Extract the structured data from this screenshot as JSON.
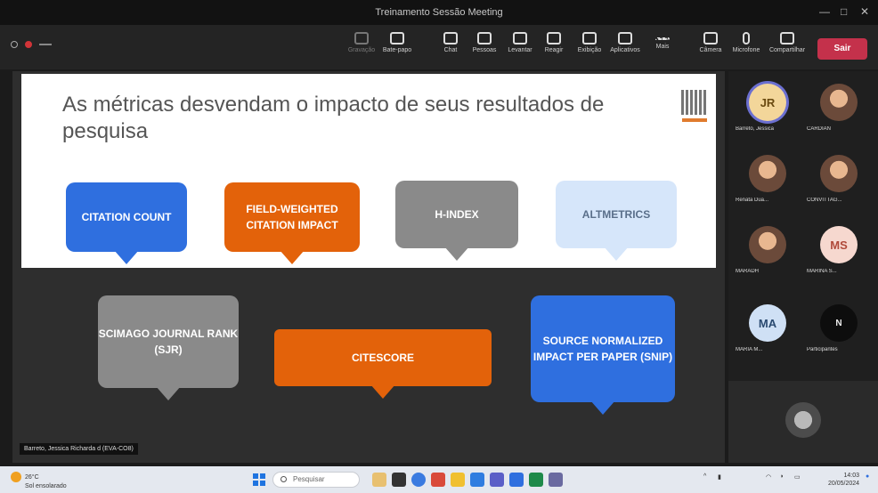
{
  "window": {
    "title": "Treinamento Sessão Meeting"
  },
  "toolbar": {
    "buttons": [
      {
        "label": "Gravação"
      },
      {
        "label": "Bate-papo"
      },
      {
        "label": "Chat"
      },
      {
        "label": "Pessoas"
      },
      {
        "label": "Levantar"
      },
      {
        "label": "Reagir"
      },
      {
        "label": "Exibição"
      },
      {
        "label": "Aplicativos"
      },
      {
        "label": "Mais"
      },
      {
        "label": "Câmera"
      },
      {
        "label": "Microfone"
      },
      {
        "label": "Compartilhar"
      }
    ],
    "leave_label": "Sair"
  },
  "slide": {
    "title": "As métricas desvendam o impacto de seus resultados de pesquisa",
    "top_metrics": [
      {
        "label": "CITATION COUNT",
        "color": "#2f6fdf"
      },
      {
        "label": "FIELD-WEIGHTED CITATION IMPACT",
        "color": "#e3620a"
      },
      {
        "label": "H-INDEX",
        "color": "#8a8a8a"
      },
      {
        "label": "ALTMETRICS",
        "color": "#d6e6fa"
      }
    ],
    "bottom_metrics": [
      {
        "label": "SCIMAGO JOURNAL RANK (SJR)",
        "color": "#8a8a8a"
      },
      {
        "label": "CITESCORE",
        "color": "#e3620a"
      },
      {
        "label": "SOURCE NORMALIZED IMPACT PER PAPER (SNIP)",
        "color": "#2f6fdf"
      }
    ]
  },
  "presenter_label": "Barreto, Jessica Richarda d (EVA-CO8)",
  "participants": [
    {
      "initials": "JR",
      "name": "Barreto, Jessica",
      "photo": false
    },
    {
      "initials": "",
      "name": "CARDIAN",
      "photo": true
    },
    {
      "initials": "",
      "name": "Renata Dua...",
      "photo": true
    },
    {
      "initials": "",
      "name": "CONVITTAG...",
      "photo": true
    },
    {
      "initials": "",
      "name": "MARADH",
      "photo": true
    },
    {
      "initials": "MS",
      "name": "MARINA S...",
      "photo": false
    },
    {
      "initials": "MA",
      "name": "MARIA M...",
      "photo": false
    },
    {
      "initials": "N",
      "name": "Participantes",
      "photo": false
    }
  ],
  "taskbar": {
    "weather_temp": "26°C",
    "weather_text": "Sol ensolarado",
    "search_placeholder": "Pesquisar",
    "time": "14:03",
    "date": "20/05/2024"
  }
}
